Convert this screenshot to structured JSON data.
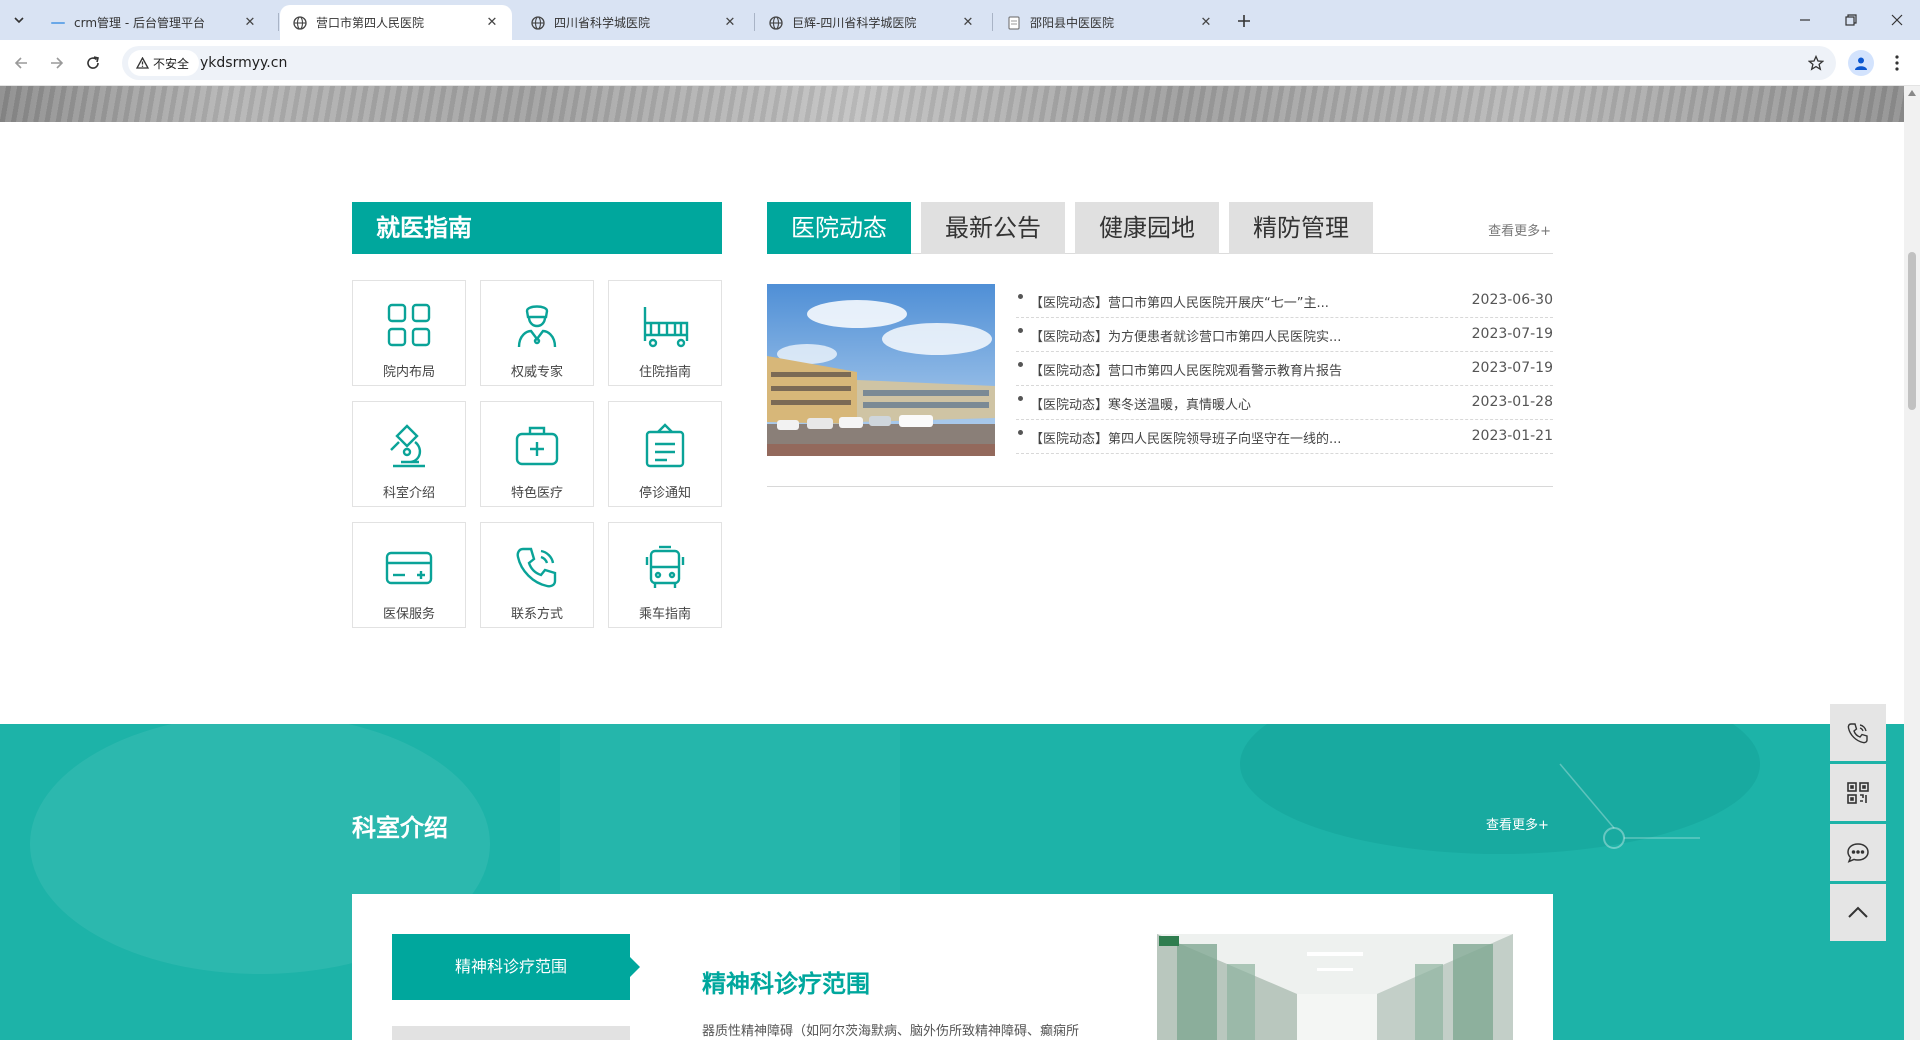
{
  "browser": {
    "tabs": [
      {
        "title": "crm管理 - 后台管理平台",
        "favicon": "crm-favicon",
        "active": false
      },
      {
        "title": "营口市第四人民医院",
        "favicon": "globe-icon",
        "active": true
      },
      {
        "title": "四川省科学城医院",
        "favicon": "globe-icon",
        "active": false
      },
      {
        "title": "巨辉-四川省科学城医院",
        "favicon": "globe-icon",
        "active": false
      },
      {
        "title": "邵阳县中医医院",
        "favicon": "page-icon",
        "active": false
      }
    ],
    "security_label": "不安全",
    "url": "ykdsrmyy.cn"
  },
  "guide": {
    "title": "就医指南",
    "items": [
      {
        "label": "院内布局",
        "icon": "grid-layout-icon"
      },
      {
        "label": "权威专家",
        "icon": "doctor-icon"
      },
      {
        "label": "住院指南",
        "icon": "hospital-bed-icon"
      },
      {
        "label": "科室介绍",
        "icon": "microscope-icon"
      },
      {
        "label": "特色医疗",
        "icon": "medical-kit-icon"
      },
      {
        "label": "停诊通知",
        "icon": "clipboard-icon"
      },
      {
        "label": "医保服务",
        "icon": "insurance-card-icon"
      },
      {
        "label": "联系方式",
        "icon": "phone-icon"
      },
      {
        "label": "乘车指南",
        "icon": "bus-icon"
      }
    ]
  },
  "news": {
    "tabs": [
      "医院动态",
      "最新公告",
      "健康园地",
      "精防管理"
    ],
    "more": "查看更多+",
    "items": [
      {
        "title": "【医院动态】营口市第四人民医院开展庆“七一”主...",
        "date": "2023-06-30"
      },
      {
        "title": "【医院动态】为方便患者就诊营口市第四人民医院实...",
        "date": "2023-07-19"
      },
      {
        "title": "【医院动态】营口市第四人民医院观看警示教育片报告",
        "date": "2023-07-19"
      },
      {
        "title": "【医院动态】寒冬送温暖，真情暖人心",
        "date": "2023-01-28"
      },
      {
        "title": "【医院动态】第四人民医院领导班子向坚守在一线的...",
        "date": "2023-01-21"
      }
    ]
  },
  "department": {
    "title": "科室介绍",
    "more": "查看更多+",
    "active_tab": "精神科诊疗范围",
    "heading": "精神科诊疗范围",
    "description": "器质性精神障碍（如阿尔茨海默病、脑外伤所致精神障碍、癫痫所"
  },
  "float_bar": [
    "phone-icon",
    "qr-code-icon",
    "chat-icon",
    "back-to-top-icon"
  ],
  "colors": {
    "primary": "#00a79d",
    "section_bg": "#1db3a8",
    "tab_inactive": "#e0e0e0"
  }
}
